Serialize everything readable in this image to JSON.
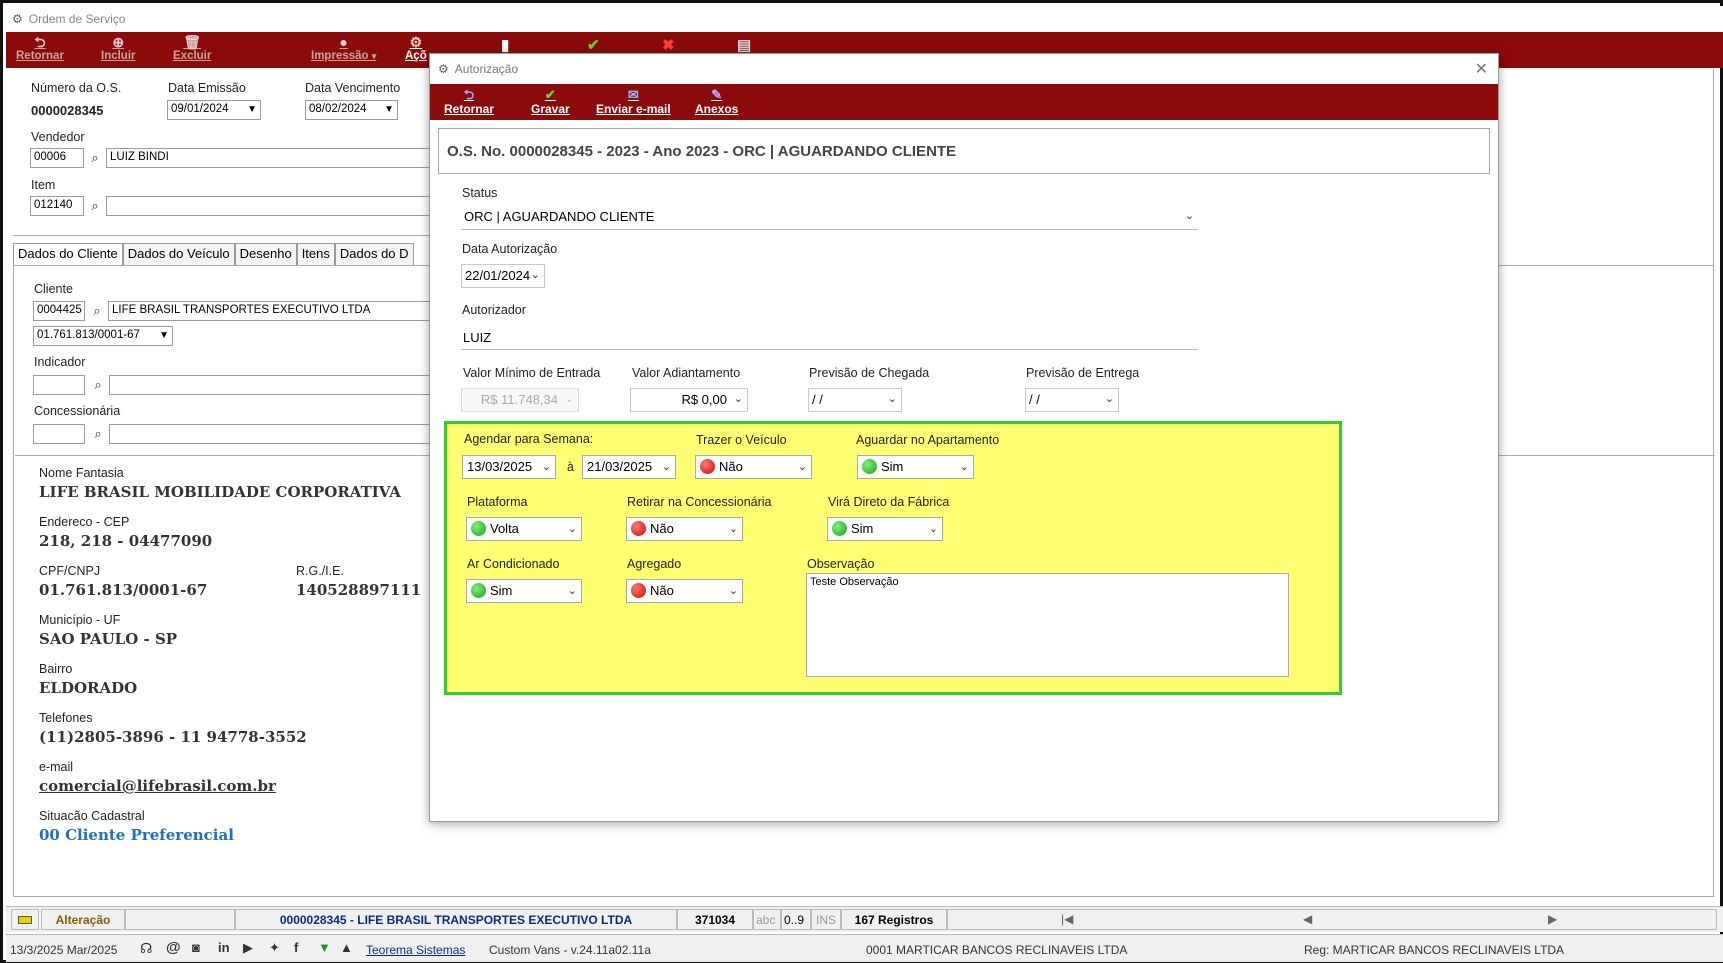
{
  "window": {
    "title": "Ordem de Serviço"
  },
  "toolbar": {
    "retornar": "Retornar",
    "incluir": "Incluir",
    "excluir": "Excluir",
    "impressao": "Impressão",
    "acoes": "Açõ"
  },
  "header": {
    "numero_label": "Número da O.S.",
    "numero_value": "0000028345",
    "emissao_label": "Data Emissão",
    "emissao_value": "09/01/2024",
    "vencimento_label": "Data Vencimento",
    "vencimento_value": "08/02/2024",
    "vendedor_label": "Vendedor",
    "vendedor_code": "00006",
    "vendedor_name": "LUIZ BINDI",
    "item_label": "Item",
    "item_code": "012140"
  },
  "tabs": [
    "Dados do Cliente",
    "Dados do Veículo",
    "Desenho",
    "Itens",
    "Dados do D"
  ],
  "cliente": {
    "label": "Cliente",
    "code": "0004425",
    "name": "LIFE BRASIL TRANSPORTES EXECUTIVO LTDA",
    "cnpj_select": "01.761.813/0001-67",
    "indicador_label": "Indicador",
    "concessionaria_label": "Concessionária",
    "fantasia_label": "Nome Fantasia",
    "fantasia_value": "LIFE BRASIL MOBILIDADE CORPORATIVA",
    "endereco_label": "Endereco - CEP",
    "endereco_value": "218, 218 - 04477090",
    "cpf_label": "CPF/CNPJ",
    "cpf_value": "01.761.813/0001-67",
    "rg_label": "R.G./I.E.",
    "rg_value": "140528897111",
    "municipio_label": "Município - UF",
    "municipio_value": "SAO PAULO - SP",
    "bairro_label": "Bairro",
    "bairro_value": "ELDORADO",
    "telefones_label": "Telefones",
    "telefones_value": "(11)2805-3896 - 11 94778-3552",
    "email_label": "e-mail",
    "email_value": "comercial@lifebrasil.com.br",
    "situacao_label": "Situacão Cadastral",
    "situacao_value": "00 Cliente Preferencial"
  },
  "statusbar": {
    "mode": "Alteração",
    "record": "0000028345 - LIFE BRASIL TRANSPORTES EXECUTIVO LTDA",
    "code": "371034",
    "abc": "abc",
    "num": "0..9",
    "ins": "INS",
    "registros": "167 Registros"
  },
  "footer": {
    "date": "13/3/2025 Mar/2025",
    "teorema": "Teorema Sistemas",
    "version": "Custom Vans - v.24.11a02.11a",
    "company": "0001 MARTICAR BANCOS RECLINAVEIS LTDA",
    "reg": "Reg: MARTICAR BANCOS RECLINAVEIS LTDA"
  },
  "dialog": {
    "title": "Autorização",
    "toolbar": {
      "retornar": "Retornar",
      "gravar": "Gravar",
      "email": "Enviar e-mail",
      "anexos": "Anexos"
    },
    "header": "O.S. No. 0000028345 -  2023 - Ano 2023 - ORC | AGUARDANDO CLIENTE",
    "status_label": "Status",
    "status_value": "ORC | AGUARDANDO CLIENTE",
    "data_aut_label": "Data Autorização",
    "data_aut_value": "22/01/2024",
    "autorizador_label": "Autorizador",
    "autorizador_value": "LUIZ",
    "valor_min_label": "Valor Mínimo de Entrada",
    "valor_min_value": "R$ 11.748,34",
    "valor_adiant_label": "Valor Adiantamento",
    "valor_adiant_value": "R$ 0,00",
    "prev_chegada_label": "Previsão de Chegada",
    "prev_chegada_value": " / /",
    "prev_entrega_label": "Previsão de Entrega",
    "prev_entrega_value": " / /",
    "agendar_label": "Agendar para Semana:",
    "semana_de": "13/03/2025",
    "semana_sep": "à",
    "semana_ate": "21/03/2025",
    "trazer_label": "Trazer o Veículo",
    "trazer_value": "Não",
    "aguardar_label": "Aguardar no Apartamento",
    "aguardar_value": "Sim",
    "plataforma_label": "Plataforma",
    "plataforma_value": "Volta",
    "retirar_label": "Retirar na Concessionária",
    "retirar_value": "Não",
    "vira_label": "Virá Direto da Fábrica",
    "vira_value": "Sim",
    "ar_label": "Ar Condicionado",
    "ar_value": "Sim",
    "agregado_label": "Agregado",
    "agregado_value": "Não",
    "obs_label": "Observação",
    "obs_value": "Teste Observação"
  },
  "colors": {
    "toolbar_bg": "#8b0b0b",
    "highlight_bg": "#ffff71",
    "highlight_border": "#33cc33",
    "status_green": "#17a017",
    "status_red": "#d00000",
    "link_blue": "#1e6fc2"
  }
}
